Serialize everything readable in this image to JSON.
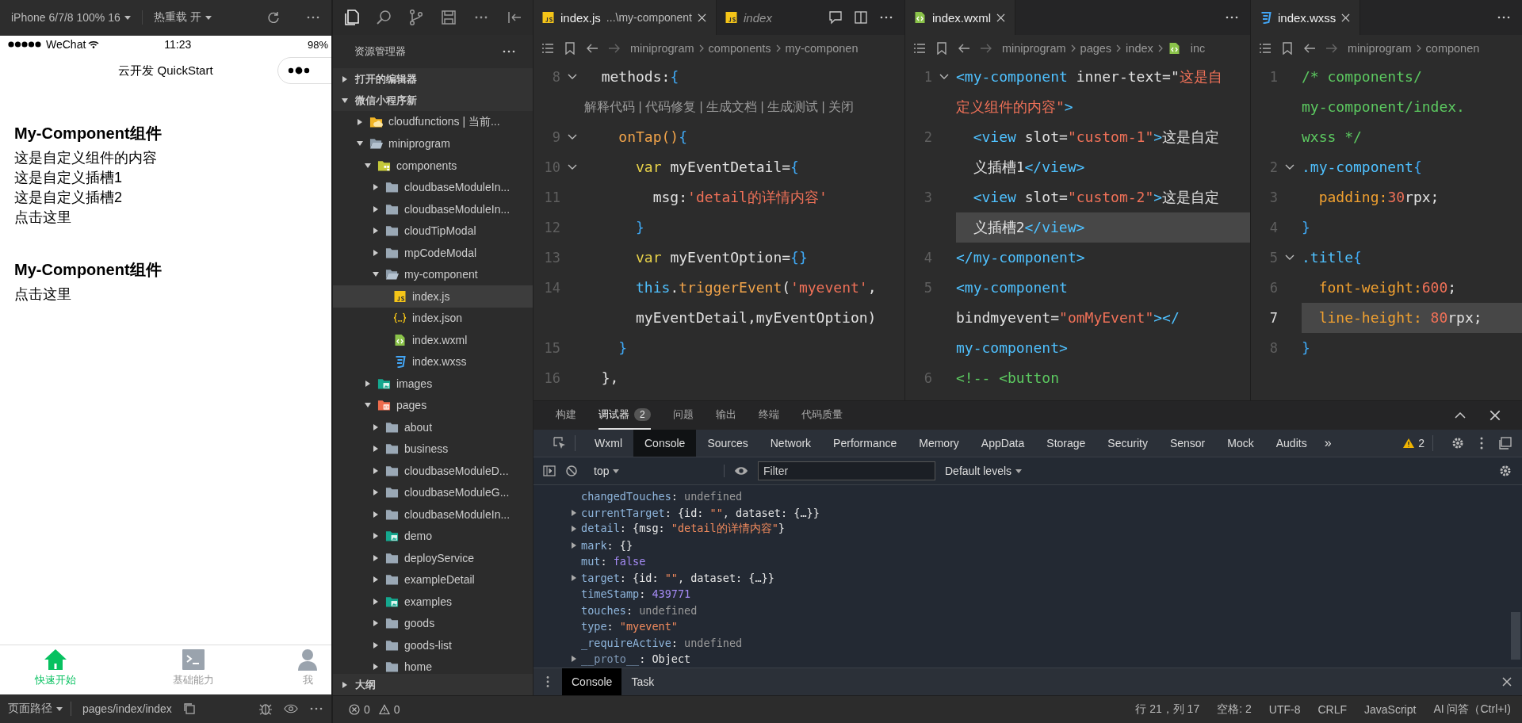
{
  "simulator": {
    "toolbar": {
      "device": "iPhone 6/7/8 100% 16",
      "hot_reload": "热重载 开"
    },
    "status_bar": {
      "carrier": "WeChat",
      "time": "11:23",
      "battery": "98%"
    },
    "nav_title": "云开发 QuickStart",
    "components": [
      {
        "title": "My-Component组件",
        "lines": [
          "这是自定义组件的内容",
          "这是自定义插槽1",
          "这是自定义插槽2",
          "点击这里"
        ]
      },
      {
        "title": "My-Component组件",
        "lines": [
          "点击这里"
        ]
      }
    ],
    "tabbar": [
      {
        "label": "快速开始",
        "kind": "home",
        "selected": true
      },
      {
        "label": "基础能力",
        "kind": "terminal",
        "selected": false
      },
      {
        "label": "我",
        "kind": "person",
        "selected": false
      }
    ],
    "page_path": {
      "label": "页面路径",
      "path": "pages/index/index"
    }
  },
  "sidebar": {
    "title": "资源管理器",
    "sections": [
      {
        "label": "打开的编辑器",
        "expanded": false
      },
      {
        "label": "微信小程序新",
        "expanded": true,
        "tree": [
          {
            "label": "cloudfunctions | 当前...",
            "kind": "cloud-folder",
            "expanded": false,
            "selected": false
          },
          {
            "label": "miniprogram",
            "kind": "folder",
            "expanded": true,
            "selected": false,
            "children": [
              {
                "label": "components",
                "kind": "component-folder",
                "expanded": true,
                "selected": false,
                "children": [
                  {
                    "label": "cloudbaseModuleIn...",
                    "kind": "folder",
                    "expanded": false,
                    "selected": false
                  },
                  {
                    "label": "cloudbaseModuleIn...",
                    "kind": "folder",
                    "expanded": false,
                    "selected": false
                  },
                  {
                    "label": "cloudTipModal",
                    "kind": "folder",
                    "expanded": false,
                    "selected": false
                  },
                  {
                    "label": "mpCodeModal",
                    "kind": "folder",
                    "expanded": false,
                    "selected": false
                  },
                  {
                    "label": "my-component",
                    "kind": "folder",
                    "expanded": true,
                    "selected": false,
                    "children": [
                      {
                        "label": "index.js",
                        "kind": "js",
                        "selected": true
                      },
                      {
                        "label": "index.json",
                        "kind": "json",
                        "selected": false
                      },
                      {
                        "label": "index.wxml",
                        "kind": "wxml",
                        "selected": false
                      },
                      {
                        "label": "index.wxss",
                        "kind": "wxss",
                        "selected": false
                      }
                    ]
                  }
                ]
              },
              {
                "label": "images",
                "kind": "image-folder",
                "expanded": false,
                "selected": false
              },
              {
                "label": "pages",
                "kind": "pages-folder",
                "expanded": true,
                "selected": false,
                "children": [
                  {
                    "label": "about",
                    "kind": "folder",
                    "expanded": false,
                    "selected": false
                  },
                  {
                    "label": "business",
                    "kind": "folder",
                    "expanded": false,
                    "selected": false
                  },
                  {
                    "label": "cloudbaseModuleD...",
                    "kind": "folder",
                    "expanded": false,
                    "selected": false
                  },
                  {
                    "label": "cloudbaseModuleG...",
                    "kind": "folder",
                    "expanded": false,
                    "selected": false
                  },
                  {
                    "label": "cloudbaseModuleIn...",
                    "kind": "folder",
                    "expanded": false,
                    "selected": false
                  },
                  {
                    "label": "demo",
                    "kind": "image-folder",
                    "expanded": false,
                    "selected": false
                  },
                  {
                    "label": "deployService",
                    "kind": "folder",
                    "expanded": false,
                    "selected": false
                  },
                  {
                    "label": "exampleDetail",
                    "kind": "folder",
                    "expanded": false,
                    "selected": false
                  },
                  {
                    "label": "examples",
                    "kind": "image-folder",
                    "expanded": false,
                    "selected": false
                  },
                  {
                    "label": "goods",
                    "kind": "folder",
                    "expanded": false,
                    "selected": false
                  },
                  {
                    "label": "goods-list",
                    "kind": "folder",
                    "expanded": false,
                    "selected": false
                  },
                  {
                    "label": "home",
                    "kind": "folder",
                    "expanded": false,
                    "selected": false
                  }
                ]
              }
            ]
          }
        ]
      },
      {
        "label": "大纲",
        "expanded": false
      }
    ]
  },
  "editors": [
    {
      "tabs": [
        {
          "label": "index.js",
          "detail": "...\\my-component",
          "kind": "js",
          "selected": true,
          "preview": false
        },
        {
          "label": "index",
          "kind": "js",
          "selected": false,
          "preview": true
        }
      ],
      "actions": true,
      "breadcrumb": [
        {
          "text": "miniprogram"
        },
        {
          "text": "components"
        },
        {
          "text": "my-componen"
        }
      ],
      "rows": [
        {
          "kind": "code",
          "number": "8",
          "fold": true,
          "active": false,
          "segs": [
            {
              "text": "  methods:",
              "kind": "plain"
            },
            {
              "text": "{",
              "kind": "brace"
            }
          ]
        },
        {
          "kind": "lens",
          "text": "解释代码 | 代码修复 | 生成文档 | 生成测试 | 关闭"
        },
        {
          "kind": "code",
          "number": "9",
          "fold": true,
          "active": false,
          "segs": [
            {
              "text": "    onTap()",
              "kind": "func"
            },
            {
              "text": "{",
              "kind": "brace"
            }
          ]
        },
        {
          "kind": "code",
          "number": "10",
          "fold": true,
          "active": false,
          "segs": [
            {
              "text": "      var",
              "kind": "keyword"
            },
            {
              "text": " myEventDetail=",
              "kind": "plain"
            },
            {
              "text": "{",
              "kind": "brace"
            }
          ]
        },
        {
          "kind": "code",
          "number": "11",
          "fold": false,
          "active": false,
          "segs": [
            {
              "text": "        msg:",
              "kind": "plain"
            },
            {
              "text": "'detail的详情内容'",
              "kind": "string"
            }
          ]
        },
        {
          "kind": "code",
          "number": "12",
          "fold": false,
          "active": false,
          "segs": [
            {
              "text": "      }",
              "kind": "brace"
            }
          ]
        },
        {
          "kind": "code",
          "number": "13",
          "fold": false,
          "active": false,
          "segs": [
            {
              "text": "      var",
              "kind": "keyword"
            },
            {
              "text": " myEventOption=",
              "kind": "plain"
            },
            {
              "text": "{}",
              "kind": "brace"
            }
          ]
        },
        {
          "kind": "code",
          "number": "14",
          "fold": false,
          "active": false,
          "segs": [
            {
              "text": "      this",
              "kind": "this"
            },
            {
              "text": ".",
              "kind": "plain"
            },
            {
              "text": "triggerEvent",
              "kind": "func"
            },
            {
              "text": "(",
              "kind": "plain"
            },
            {
              "text": "'myevent'",
              "kind": "string"
            },
            {
              "text": ",",
              "kind": "plain"
            }
          ]
        },
        {
          "kind": "code",
          "fold": false,
          "active": false,
          "segs": [
            {
              "text": "      myEventDetail,myEventOption)",
              "kind": "plain"
            }
          ]
        },
        {
          "kind": "code",
          "number": "15",
          "fold": false,
          "active": false,
          "segs": [
            {
              "text": "    }",
              "kind": "brace"
            }
          ]
        },
        {
          "kind": "code",
          "number": "16",
          "fold": false,
          "active": false,
          "segs": [
            {
              "text": "  },",
              "kind": "plain"
            }
          ]
        }
      ]
    },
    {
      "tabs": [
        {
          "label": "index.wxml",
          "kind": "wxml",
          "selected": true,
          "preview": false
        }
      ],
      "actions": false,
      "breadcrumb": [
        {
          "text": "miniprogram"
        },
        {
          "text": "pages"
        },
        {
          "text": "index"
        },
        {
          "text": "inc",
          "kind": "wxml"
        }
      ],
      "rows": [
        {
          "kind": "code",
          "number": "1",
          "fold": true,
          "active": false,
          "segs": [
            {
              "text": "<my-component",
              "kind": "tag"
            },
            {
              "text": " inner-text=\"",
              "kind": "attr"
            },
            {
              "text": "这是自",
              "kind": "string"
            }
          ]
        },
        {
          "kind": "code",
          "fold": false,
          "active": false,
          "segs": [
            {
              "text": "定义组件的内容\"",
              "kind": "string"
            },
            {
              "text": ">",
              "kind": "tag"
            }
          ]
        },
        {
          "kind": "code",
          "number": "2",
          "fold": false,
          "active": false,
          "segs": [
            {
              "text": "  <view",
              "kind": "tag"
            },
            {
              "text": " slot=",
              "kind": "attr"
            },
            {
              "text": "\"custom-1\"",
              "kind": "string"
            },
            {
              "text": ">",
              "kind": "tag"
            },
            {
              "text": "这是自定",
              "kind": "plain"
            }
          ]
        },
        {
          "kind": "code",
          "fold": false,
          "active": false,
          "segs": [
            {
              "text": "  义插槽1",
              "kind": "plain"
            },
            {
              "text": "</view>",
              "kind": "tag"
            }
          ]
        },
        {
          "kind": "code",
          "number": "3",
          "fold": false,
          "active": false,
          "segs": [
            {
              "text": "  <view",
              "kind": "tag"
            },
            {
              "text": " slot=",
              "kind": "attr"
            },
            {
              "text": "\"custom-2\"",
              "kind": "string"
            },
            {
              "text": ">",
              "kind": "tag"
            },
            {
              "text": "这是自定",
              "kind": "plain"
            }
          ]
        },
        {
          "kind": "code",
          "fold": false,
          "active": true,
          "segs": [
            {
              "text": "  义插槽2",
              "kind": "plain"
            },
            {
              "text": "</view>",
              "kind": "tag"
            }
          ]
        },
        {
          "kind": "code",
          "number": "4",
          "fold": false,
          "active": false,
          "segs": [
            {
              "text": "</my-component>",
              "kind": "tag"
            }
          ]
        },
        {
          "kind": "code",
          "number": "5",
          "fold": false,
          "active": false,
          "segs": [
            {
              "text": "<my-component",
              "kind": "tag"
            }
          ]
        },
        {
          "kind": "code",
          "fold": false,
          "active": false,
          "segs": [
            {
              "text": "bindmyevent=",
              "kind": "attr"
            },
            {
              "text": "\"omMyEvent\"",
              "kind": "string"
            },
            {
              "text": "></",
              "kind": "tag"
            }
          ]
        },
        {
          "kind": "code",
          "fold": false,
          "active": false,
          "segs": [
            {
              "text": "my-component>",
              "kind": "tag"
            }
          ]
        },
        {
          "kind": "code",
          "number": "6",
          "fold": false,
          "active": false,
          "segs": [
            {
              "text": "<!-- <button",
              "kind": "comment"
            }
          ]
        }
      ]
    },
    {
      "tabs": [
        {
          "label": "index.wxss",
          "kind": "wxss",
          "selected": true,
          "preview": false
        }
      ],
      "actions": false,
      "breadcrumb": [
        {
          "text": "miniprogram"
        },
        {
          "text": "componen"
        }
      ],
      "rows": [
        {
          "kind": "code",
          "number": "1",
          "fold": false,
          "active": false,
          "segs": [
            {
              "text": "/* components/",
              "kind": "comment"
            }
          ]
        },
        {
          "kind": "code",
          "fold": false,
          "active": false,
          "segs": [
            {
              "text": "my-component/index.",
              "kind": "comment"
            }
          ]
        },
        {
          "kind": "code",
          "fold": false,
          "active": false,
          "segs": [
            {
              "text": "wxss */",
              "kind": "comment"
            }
          ]
        },
        {
          "kind": "code",
          "number": "2",
          "fold": true,
          "active": false,
          "segs": [
            {
              "text": ".my-component",
              "kind": "selector"
            },
            {
              "text": "{",
              "kind": "brace"
            }
          ]
        },
        {
          "kind": "code",
          "number": "3",
          "fold": false,
          "active": false,
          "segs": [
            {
              "text": "  padding:",
              "kind": "property"
            },
            {
              "text": "30",
              "kind": "number"
            },
            {
              "text": "rpx;",
              "kind": "plain"
            }
          ]
        },
        {
          "kind": "code",
          "number": "4",
          "fold": false,
          "active": false,
          "segs": [
            {
              "text": "}",
              "kind": "brace"
            }
          ]
        },
        {
          "kind": "code",
          "number": "5",
          "fold": true,
          "active": false,
          "segs": [
            {
              "text": ".title",
              "kind": "selector"
            },
            {
              "text": "{",
              "kind": "brace"
            }
          ]
        },
        {
          "kind": "code",
          "number": "6",
          "fold": false,
          "active": false,
          "segs": [
            {
              "text": "  font-weight:",
              "kind": "property"
            },
            {
              "text": "600",
              "kind": "number"
            },
            {
              "text": ";",
              "kind": "plain"
            }
          ]
        },
        {
          "kind": "code",
          "number": "7",
          "fold": false,
          "active": true,
          "segs": [
            {
              "text": "  line-height: ",
              "kind": "property"
            },
            {
              "text": "80",
              "kind": "number"
            },
            {
              "text": "rpx;",
              "kind": "plain"
            }
          ]
        },
        {
          "kind": "code",
          "number": "8",
          "fold": false,
          "active": false,
          "segs": [
            {
              "text": "}",
              "kind": "brace"
            }
          ]
        }
      ]
    }
  ],
  "panel": {
    "tabs": [
      {
        "label": "构建",
        "selected": false
      },
      {
        "label": "调试器",
        "selected": true,
        "badge": "2"
      },
      {
        "label": "问题",
        "selected": false
      },
      {
        "label": "输出",
        "selected": false
      },
      {
        "label": "终端",
        "selected": false
      },
      {
        "label": "代码质量",
        "selected": false
      }
    ],
    "devtools": {
      "tabs": [
        {
          "label": "Wxml",
          "selected": false
        },
        {
          "label": "Console",
          "selected": true
        },
        {
          "label": "Sources",
          "selected": false
        },
        {
          "label": "Network",
          "selected": false
        },
        {
          "label": "Performance",
          "selected": false
        },
        {
          "label": "Memory",
          "selected": false
        },
        {
          "label": "AppData",
          "selected": false
        },
        {
          "label": "Storage",
          "selected": false
        },
        {
          "label": "Security",
          "selected": false
        },
        {
          "label": "Sensor",
          "selected": false
        },
        {
          "label": "Mock",
          "selected": false
        },
        {
          "label": "Audits",
          "selected": false
        }
      ],
      "more": "»",
      "warnings": "2"
    },
    "console": {
      "context": "top",
      "filter_placeholder": "Filter",
      "levels": "Default levels",
      "lines": [
        {
          "expandable": false,
          "segs": [
            {
              "text": "changedTouches",
              "kind": "key"
            },
            {
              "text": ": ",
              "kind": "plain"
            },
            {
              "text": "undefined",
              "kind": "null"
            }
          ]
        },
        {
          "expandable": true,
          "segs": [
            {
              "text": "currentTarget",
              "kind": "key"
            },
            {
              "text": ": {id: ",
              "kind": "plain"
            },
            {
              "text": "\"\"",
              "kind": "string"
            },
            {
              "text": ", dataset: {…}}",
              "kind": "plain"
            }
          ]
        },
        {
          "expandable": true,
          "segs": [
            {
              "text": "detail",
              "kind": "key"
            },
            {
              "text": ": {msg: ",
              "kind": "plain"
            },
            {
              "text": "\"detail的详情内容\"",
              "kind": "string"
            },
            {
              "text": "}",
              "kind": "plain"
            }
          ]
        },
        {
          "expandable": true,
          "segs": [
            {
              "text": "mark",
              "kind": "key"
            },
            {
              "text": ": {}",
              "kind": "plain"
            }
          ]
        },
        {
          "expandable": false,
          "segs": [
            {
              "text": "mut",
              "kind": "key"
            },
            {
              "text": ": ",
              "kind": "plain"
            },
            {
              "text": "false",
              "kind": "number"
            }
          ]
        },
        {
          "expandable": true,
          "segs": [
            {
              "text": "target",
              "kind": "key"
            },
            {
              "text": ": {id: ",
              "kind": "plain"
            },
            {
              "text": "\"\"",
              "kind": "string"
            },
            {
              "text": ", dataset: {…}}",
              "kind": "plain"
            }
          ]
        },
        {
          "expandable": false,
          "segs": [
            {
              "text": "timeStamp",
              "kind": "key"
            },
            {
              "text": ": ",
              "kind": "plain"
            },
            {
              "text": "439771",
              "kind": "number"
            }
          ]
        },
        {
          "expandable": false,
          "segs": [
            {
              "text": "touches",
              "kind": "key"
            },
            {
              "text": ": ",
              "kind": "plain"
            },
            {
              "text": "undefined",
              "kind": "null"
            }
          ]
        },
        {
          "expandable": false,
          "segs": [
            {
              "text": "type",
              "kind": "key"
            },
            {
              "text": ": ",
              "kind": "plain"
            },
            {
              "text": "\"myevent\"",
              "kind": "string"
            }
          ]
        },
        {
          "expandable": false,
          "segs": [
            {
              "text": "_requireActive",
              "kind": "key"
            },
            {
              "text": ": ",
              "kind": "plain"
            },
            {
              "text": "undefined",
              "kind": "null"
            }
          ]
        },
        {
          "expandable": true,
          "segs": [
            {
              "text": "__proto__",
              "kind": "dim"
            },
            {
              "text": ": Object",
              "kind": "plain"
            }
          ]
        }
      ]
    },
    "drawer": [
      {
        "label": "Console",
        "selected": true
      },
      {
        "label": "Task",
        "selected": false
      }
    ]
  },
  "status_bar": {
    "errors": "0",
    "warnings": "0",
    "items": [
      "行 21，列 17",
      "空格: 2",
      "UTF-8",
      "CRLF",
      "JavaScript",
      "AI 问答（Ctrl+I)"
    ]
  }
}
